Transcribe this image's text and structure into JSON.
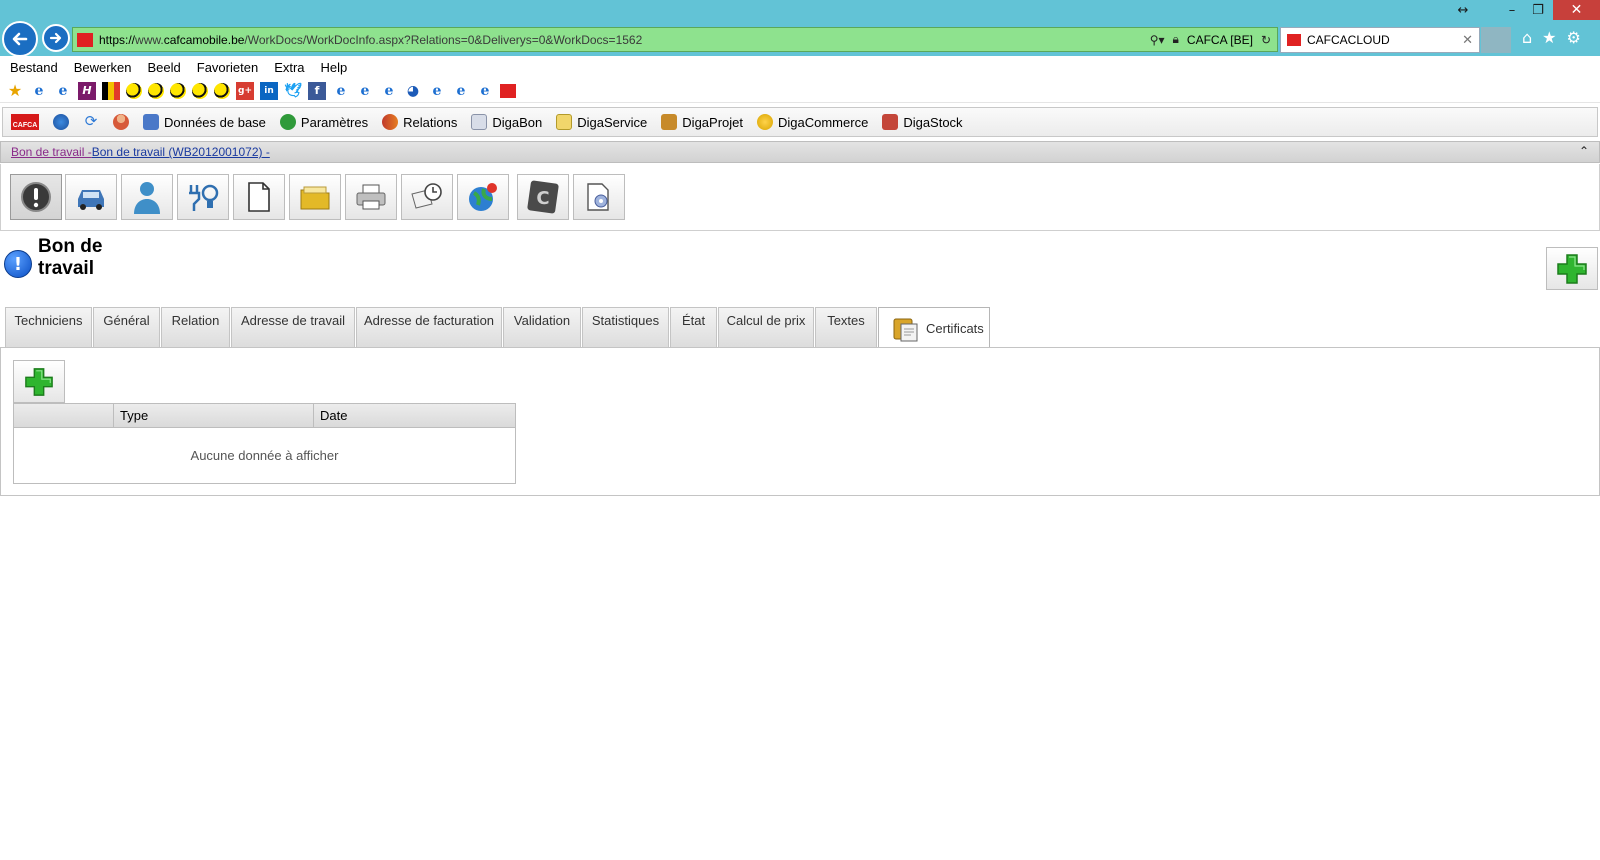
{
  "browser": {
    "url_protocol": "https://",
    "url_host_pre": "www.",
    "url_domain": "cafcamobile.be",
    "url_path": "/WorkDocs/WorkDocInfo.aspx?Relations=0&Deliverys=0&WorkDocs=1562",
    "site_identity": "CAFCA [BE]",
    "tab_title": "CAFCACLOUD",
    "window_controls": {
      "resize": "↔",
      "minimize": "–",
      "maximize": "❐",
      "close": "✕"
    }
  },
  "menubar": {
    "items": [
      "Bestand",
      "Bewerken",
      "Beeld",
      "Favorieten",
      "Extra",
      "Help"
    ]
  },
  "app_toolbar": {
    "logo_text": "CAFCA",
    "items": [
      "Données de base",
      "Paramètres",
      "Relations",
      "DigaBon",
      "DigaService",
      "DigaProjet",
      "DigaCommerce",
      "DigaStock"
    ]
  },
  "breadcrumb": {
    "part1": "Bon de travail - ",
    "part2": "Bon de travail (WB2012001072) -",
    "collapse": "⌃"
  },
  "page": {
    "title": "Bon de travail",
    "info_glyph": "!"
  },
  "tabs": [
    "Techniciens",
    "Général",
    "Relation",
    "Adresse de travail",
    "Adresse de facturation",
    "Validation",
    "Statistiques",
    "État",
    "Calcul de prix",
    "Textes",
    "Certificats"
  ],
  "active_tab": "Certificats",
  "certificates_grid": {
    "columns": [
      "",
      "Type",
      "Date"
    ],
    "empty_message": "Aucune donnée à afficher"
  },
  "colors": {
    "titlebar": "#62c3d6",
    "addressbar": "#8ee28e",
    "close_button": "#c7403b",
    "plus_green": "#2fb52f",
    "link_visited": "#8a2b8a",
    "link": "#1a3aa0"
  }
}
